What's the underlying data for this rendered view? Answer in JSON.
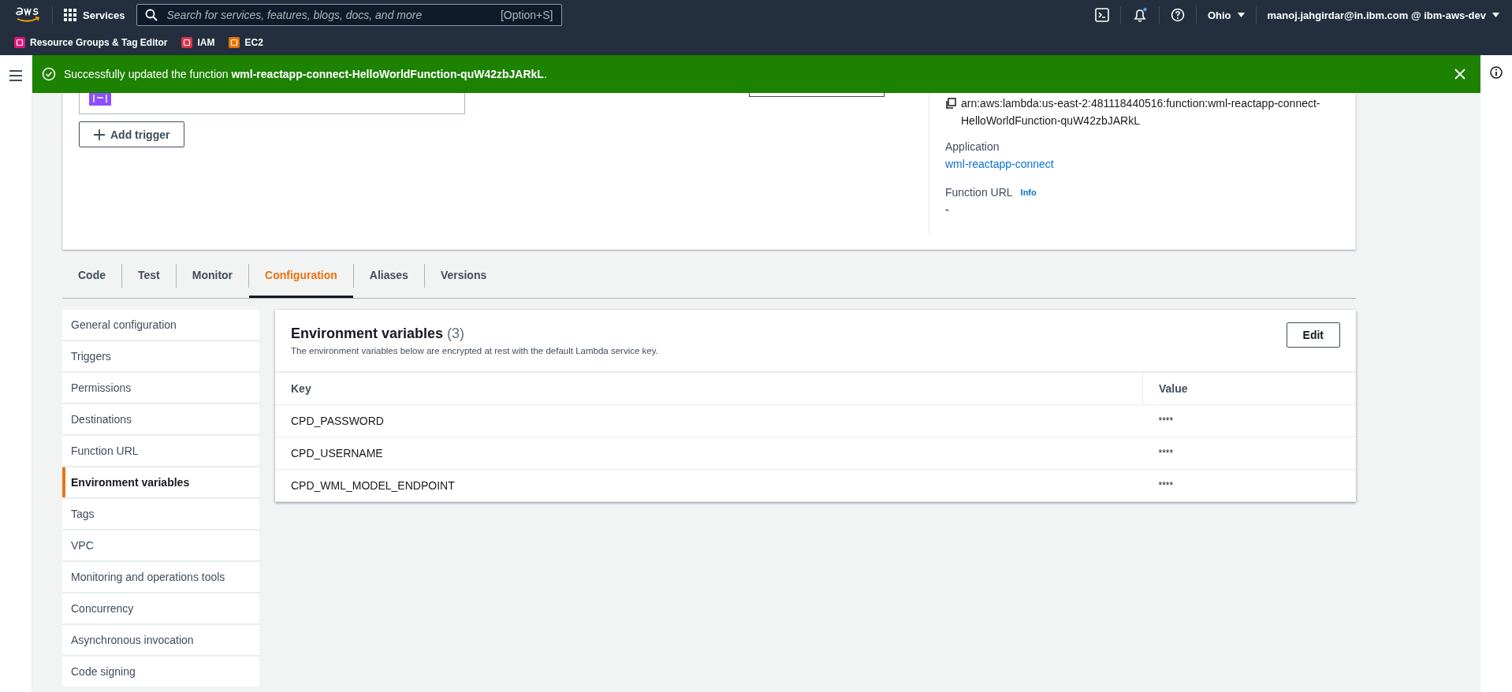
{
  "nav": {
    "services": "Services",
    "search_placeholder": "Search for services, features, blogs, docs, and more",
    "search_shortcut": "[Option+S]",
    "region": "Ohio",
    "account": "manoj.jahgirdar@in.ibm.com @ ibm-aws-dev"
  },
  "favorites": [
    {
      "label": "Resource Groups & Tag Editor",
      "color": "#e7157b"
    },
    {
      "label": "IAM",
      "color": "#dd344c"
    },
    {
      "label": "EC2",
      "color": "#ed7100"
    }
  ],
  "flash": {
    "text": "Successfully updated the function **wml-reactapp-connect-HelloWorldFunction-quW42zbJARkL**."
  },
  "overview": {
    "add_trigger": "Add trigger",
    "arn": "arn:aws:lambda:us-east-2:481118440516:function:wml-reactapp-connect-HelloWorldFunction-quW42zbJARkL",
    "application_label": "Application",
    "application": "wml-reactapp-connect",
    "function_url_label": "Function URL",
    "info": "Info",
    "function_url": "-"
  },
  "tabs": [
    {
      "label": "Code",
      "selected": false
    },
    {
      "label": "Test",
      "selected": false
    },
    {
      "label": "Monitor",
      "selected": false
    },
    {
      "label": "Configuration",
      "selected": true
    },
    {
      "label": "Aliases",
      "selected": false
    },
    {
      "label": "Versions",
      "selected": false
    }
  ],
  "sidebar": [
    {
      "label": "General configuration",
      "selected": false
    },
    {
      "label": "Triggers",
      "selected": false
    },
    {
      "label": "Permissions",
      "selected": false
    },
    {
      "label": "Destinations",
      "selected": false
    },
    {
      "label": "Function URL",
      "selected": false
    },
    {
      "label": "Environment variables",
      "selected": true
    },
    {
      "label": "Tags",
      "selected": false
    },
    {
      "label": "VPC",
      "selected": false
    },
    {
      "label": "Monitoring and operations tools",
      "selected": false
    },
    {
      "label": "Concurrency",
      "selected": false
    },
    {
      "label": "Asynchronous invocation",
      "selected": false
    },
    {
      "label": "Code signing",
      "selected": false
    }
  ],
  "env": {
    "title": "Environment variables",
    "count": "(3)",
    "description": "The environment variables below are encrypted at rest with the default Lambda service key.",
    "edit": "Edit",
    "columns": [
      "Key",
      "Value"
    ],
    "rows": [
      {
        "key": "CPD_PASSWORD",
        "value": "****"
      },
      {
        "key": "CPD_USERNAME",
        "value": "****"
      },
      {
        "key": "CPD_WML_MODEL_ENDPOINT",
        "value": "****"
      }
    ]
  }
}
